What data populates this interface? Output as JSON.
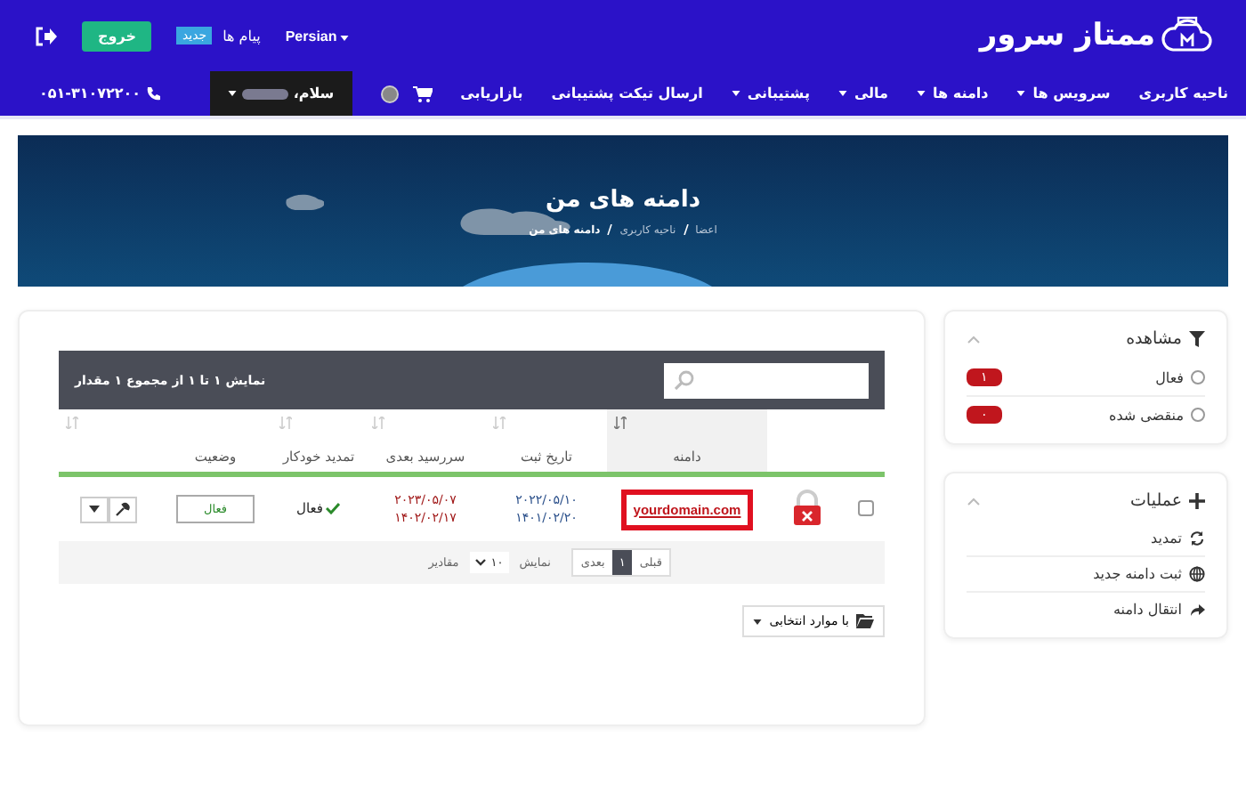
{
  "topbar": {
    "logo": "ممتاز سرور",
    "language": "Persian",
    "messages": "پیام ها",
    "messages_badge": "جدید",
    "logout": "خروج"
  },
  "nav": {
    "items": [
      {
        "label": "ناحیه کاربری",
        "dropdown": false
      },
      {
        "label": "سرویس ها",
        "dropdown": true
      },
      {
        "label": "دامنه ها",
        "dropdown": true
      },
      {
        "label": "مالی",
        "dropdown": true
      },
      {
        "label": "پشتیبانی",
        "dropdown": true
      },
      {
        "label": "ارسال تیکت پشتیبانی",
        "dropdown": false
      },
      {
        "label": "بازاریابی",
        "dropdown": false
      }
    ],
    "greeting": "سلام،",
    "phone": "۰۵۱-۳۱۰۷۲۲۰۰"
  },
  "banner": {
    "title": "دامنه های من",
    "breadcrumb": [
      {
        "label": "اعضا",
        "current": false
      },
      {
        "label": "ناحیه کاربری",
        "current": false
      },
      {
        "label": "دامنه های من",
        "current": true
      }
    ]
  },
  "sidebar": [
    {
      "title": "مشاهده",
      "kind": "filter",
      "items": [
        {
          "label": "فعال",
          "count": "۱",
          "selected": false
        },
        {
          "label": "منقضی شده",
          "count": "۰",
          "selected": false
        }
      ]
    },
    {
      "title": "عملیات",
      "kind": "actions",
      "items": [
        {
          "label": "تمدید",
          "kind": "refresh"
        },
        {
          "label": "ثبت دامنه جدید",
          "kind": "globe"
        },
        {
          "label": "انتقال دامنه",
          "kind": "share"
        }
      ]
    }
  ],
  "table": {
    "summary": "نمایش ۱ تا ۱ از مجموع ۱ مقدار",
    "columns": [
      {
        "sortable": false,
        "sorted": false
      },
      {
        "sortable": false,
        "sorted": false
      },
      {
        "label": "دامنه",
        "sortable": true,
        "sorted": true
      },
      {
        "label": "تاریخ ثبت",
        "sortable": true,
        "sorted": false
      },
      {
        "label": "سررسید بعدی",
        "sortable": true,
        "sorted": false
      },
      {
        "label": "تمدید خودکار",
        "sortable": true,
        "sorted": false
      },
      {
        "label": "وضعیت",
        "sortable": false,
        "sorted": false
      },
      {
        "sortable": true,
        "sorted": false
      }
    ],
    "rows": [
      {
        "checked": false,
        "locked": true,
        "domain": "yourdomain.com",
        "highlighted": true,
        "registered": [
          "۲۰۲۲/۰۵/۱۰",
          "۱۴۰۱/۰۲/۲۰"
        ],
        "expiry": [
          "۲۰۲۳/۰۵/۰۷",
          "۱۴۰۲/۰۲/۱۷"
        ],
        "auto_renew": "فعال",
        "auto_renew_on": true,
        "status": "فعال"
      }
    ],
    "show_label": "نمایش",
    "page_size": "۱۰",
    "page_size_unit": "مقادیر",
    "pages": [
      {
        "label": "قبلی",
        "selected": false
      },
      {
        "label": "۱",
        "selected": true
      },
      {
        "label": "بعدی",
        "selected": false
      }
    ],
    "bulk": "با موارد انتخابی"
  }
}
